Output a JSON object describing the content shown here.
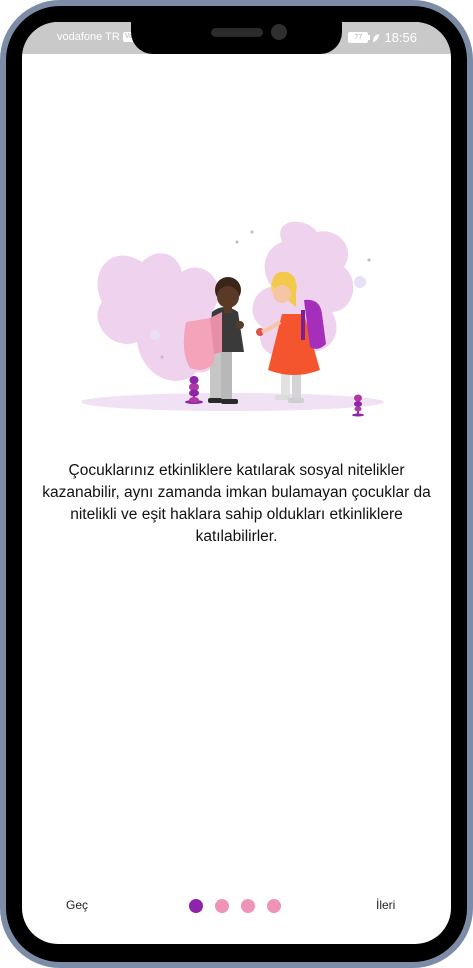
{
  "status_bar": {
    "carrier": "vodafone TR",
    "network_badge": "VoLTE",
    "battery_level": "77",
    "time": "18:56"
  },
  "onboarding": {
    "description": "Çocuklarınız etkinliklere katılarak sosyal nitelikler kazanabilir, aynı zamanda imkan bulamayan çocuklar da nitelikli ve eşit haklara sahip oldukları etkinliklere katılabilirler.",
    "skip_label": "Geç",
    "next_label": "İleri",
    "page_count": 4,
    "current_page": 1
  },
  "colors": {
    "accent": "#8e24aa",
    "dot_inactive": "#f093b8",
    "frame": "#7d8ca6",
    "statusbar": "#c9c9c9"
  }
}
